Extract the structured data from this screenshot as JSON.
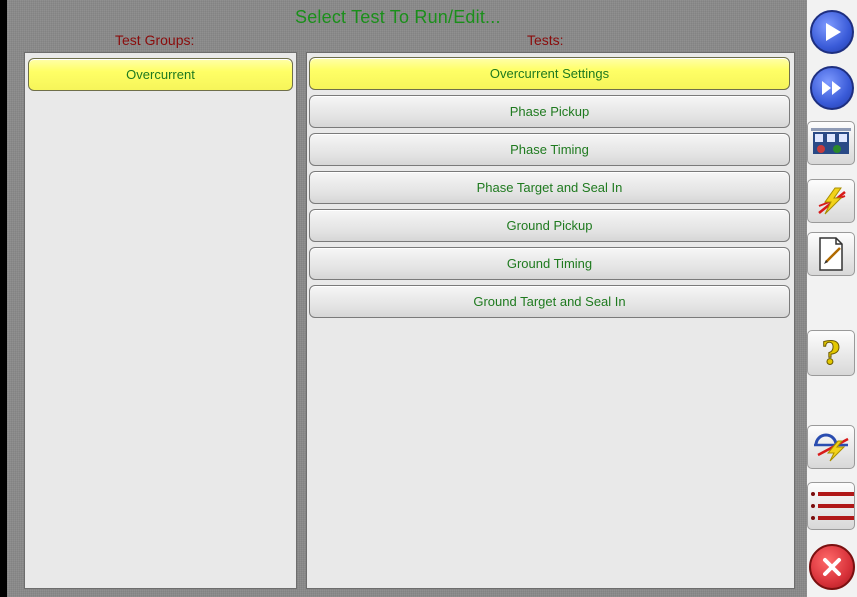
{
  "window": {
    "title": "Select Test To Run/Edit..."
  },
  "groups": {
    "label": "Test Groups:",
    "items": [
      {
        "label": "Overcurrent",
        "selected": true
      }
    ]
  },
  "tests": {
    "label": "Tests:",
    "items": [
      {
        "label": "Overcurrent Settings",
        "selected": true
      },
      {
        "label": "Phase Pickup",
        "selected": false
      },
      {
        "label": "Phase Timing",
        "selected": false
      },
      {
        "label": "Phase Target and Seal In",
        "selected": false
      },
      {
        "label": "Ground Pickup",
        "selected": false
      },
      {
        "label": "Ground Timing",
        "selected": false
      },
      {
        "label": "Ground Target and Seal In",
        "selected": false
      }
    ]
  },
  "toolbar": {
    "buttons": [
      {
        "name": "play-icon"
      },
      {
        "name": "fast-forward-icon"
      },
      {
        "name": "test-settings-icon"
      },
      {
        "name": "lightning-icon"
      },
      {
        "name": "report-edit-icon"
      },
      {
        "name": "help-icon",
        "glyph": "?"
      },
      {
        "name": "relay-settings-icon"
      },
      {
        "name": "list-icon"
      },
      {
        "name": "close-icon"
      }
    ]
  },
  "colors": {
    "title": "#1a8f1a",
    "column_label": "#8a0c0c",
    "item_text": "#1f7a1f",
    "selected": "#ffff66",
    "accent_blue": "#3a5bd8",
    "close_red": "#d8323a"
  }
}
